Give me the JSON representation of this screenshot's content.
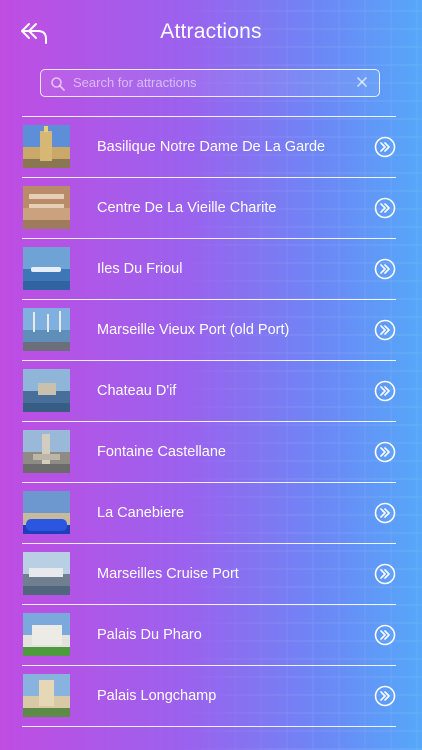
{
  "header": {
    "title": "Attractions",
    "back_icon": "back-arrow-icon"
  },
  "search": {
    "placeholder": "Search for attractions",
    "value": "",
    "icon": "search-icon",
    "clear_icon": "close-icon"
  },
  "attractions": [
    {
      "name": "Basilique Notre Dame De La Garde"
    },
    {
      "name": "Centre De La Vieille Charite"
    },
    {
      "name": "Iles Du Frioul"
    },
    {
      "name": "Marseille Vieux Port (old Port)"
    },
    {
      "name": "Chateau D'if"
    },
    {
      "name": "Fontaine Castellane"
    },
    {
      "name": "La Canebiere"
    },
    {
      "name": "Marseilles Cruise Port"
    },
    {
      "name": "Palais Du Pharo"
    },
    {
      "name": "Palais Longchamp"
    }
  ],
  "row_action_icon": "chevron-double-right-icon",
  "colors": {
    "gradient_left": "#c04de2",
    "gradient_right": "#55a8f9",
    "text": "#ffffff"
  }
}
